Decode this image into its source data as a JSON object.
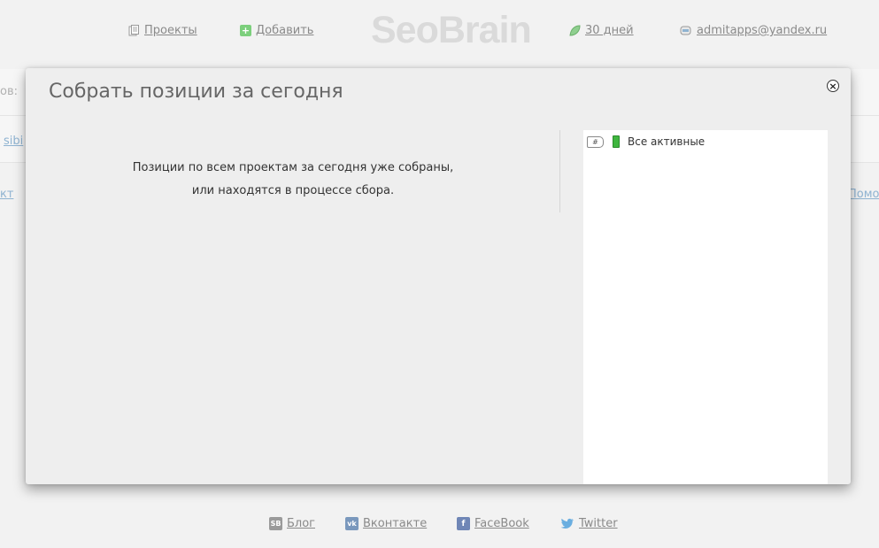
{
  "header": {
    "projects_label": "Проекты",
    "add_label": "Добавить",
    "logo": "SeoBrain",
    "days_label": "30 дней",
    "email": "admitapps@yandex.ru"
  },
  "background": {
    "frag_left_1": "ов:",
    "frag_left_2": "sibi",
    "frag_left_3": "кт",
    "frag_right_1": "Помо"
  },
  "modal": {
    "title": "Собрать позиции за сегодня",
    "message_line1": "Позиции по всем проектам за сегодня уже собраны,",
    "message_line2": "или находятся в процессе сбора.",
    "list_item_label": "Все активные",
    "tag_text": "#"
  },
  "footer": {
    "blog": "Блог",
    "blog_badge": "SB",
    "vk": "Вконтакте",
    "vk_badge": "vk",
    "facebook": "FaceBook",
    "facebook_badge": "f",
    "twitter": "Twitter"
  },
  "colors": {
    "accent_green": "#3fb63f",
    "link_gray": "#8a8a8a",
    "vk_blue": "#7a98bd",
    "fb_blue": "#6f86b6",
    "twitter_blue": "#6aaee0"
  }
}
